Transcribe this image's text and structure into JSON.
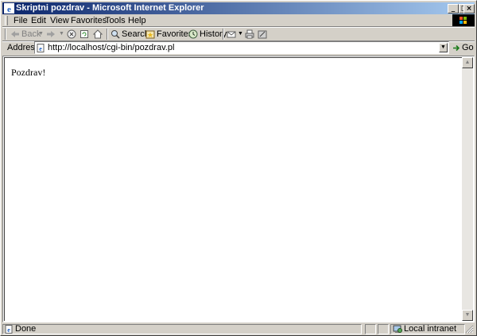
{
  "window": {
    "title": "Skriptni pozdrav - Microsoft Internet Explorer"
  },
  "menu": [
    "File",
    "Edit",
    "View",
    "Favorites",
    "Tools",
    "Help"
  ],
  "toolbar": {
    "back_label": "Back",
    "search_label": "Search",
    "favorites_label": "Favorites",
    "history_label": "History"
  },
  "address": {
    "label": "Address",
    "url": "http://localhost/cgi-bin/pozdrav.pl",
    "go_label": "Go"
  },
  "page": {
    "text": "Pozdrav!"
  },
  "status": {
    "text": "Done",
    "zone": "Local intranet"
  },
  "icons": {
    "window_controls": [
      "minimize-icon",
      "maximize-icon",
      "close-icon"
    ],
    "toolbar": [
      "back-icon",
      "forward-icon",
      "stop-icon",
      "refresh-icon",
      "home-icon",
      "search-icon",
      "favorites-icon",
      "history-icon",
      "mail-icon",
      "print-icon",
      "edit-icon"
    ]
  },
  "colors": {
    "title_start": "#0a246a",
    "title_end": "#a6caf0",
    "chrome": "#d4d0c8"
  }
}
